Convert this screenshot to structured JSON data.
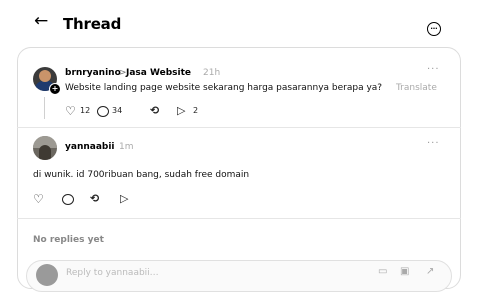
{
  "topbar": {
    "back": "←",
    "title": "Thread",
    "more": "…"
  },
  "post": {
    "username": "brnryanino",
    "separator": ">",
    "community": "Jasa Website",
    "time": "21h",
    "text": "Website landing page website sekarang harga pasarannya berapa ya?",
    "translate": "Translate",
    "more": "···",
    "likes": "12",
    "comments": "34",
    "shares": "2",
    "badge": "+"
  },
  "reply": {
    "username": "yannaabii",
    "time": "1m",
    "text": "di wunik. id 700ribuan bang, sudah free domain",
    "more": "···"
  },
  "footer": {
    "no_replies": "No replies yet",
    "composer_placeholder": "Reply to yannaabii…"
  },
  "icons": {
    "heart": "heart-icon",
    "comment": "comment-icon",
    "repost": "repost-icon",
    "share": "share-icon"
  }
}
